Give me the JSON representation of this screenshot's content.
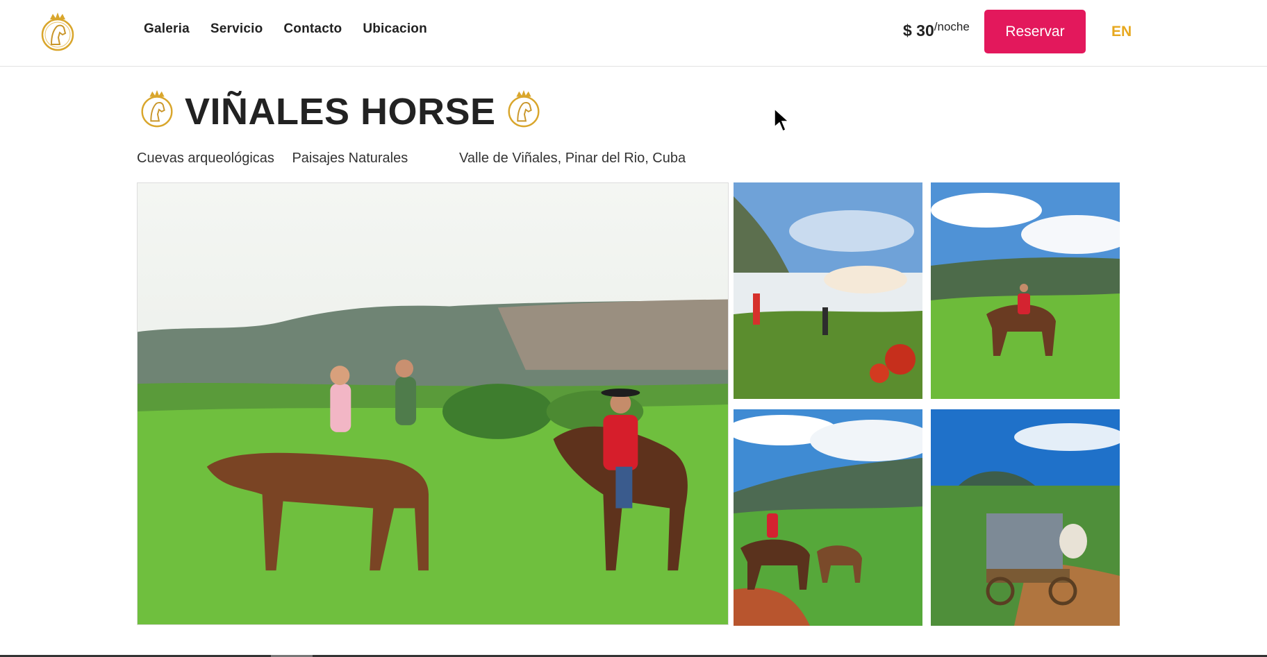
{
  "colors": {
    "accent": "#e3185c",
    "gold": "#e7a81f",
    "text": "#222222"
  },
  "header": {
    "logo_icon": "horse-crown-logo-icon",
    "nav": [
      {
        "label": "Galeria"
      },
      {
        "label": "Servicio"
      },
      {
        "label": "Contacto"
      },
      {
        "label": "Ubicacion"
      }
    ],
    "price": {
      "amount": "$ 30",
      "unit": "/noche"
    },
    "reserve_label": "Reservar",
    "language": "EN"
  },
  "hero": {
    "title": "VIÑALES HORSE",
    "tags": [
      "Cuevas arqueológicas",
      "Paisajes Naturales"
    ],
    "location": "Valle de Viñales, Pinar del Rio, Cuba"
  },
  "gallery": {
    "photos": [
      {
        "icon": "horseback-riders-valley-photo"
      },
      {
        "icon": "sunrise-valley-photo"
      },
      {
        "icon": "rider-on-meadow-photo"
      },
      {
        "icon": "riders-near-mogotes-photo"
      },
      {
        "icon": "oxcart-tour-photo"
      }
    ]
  }
}
